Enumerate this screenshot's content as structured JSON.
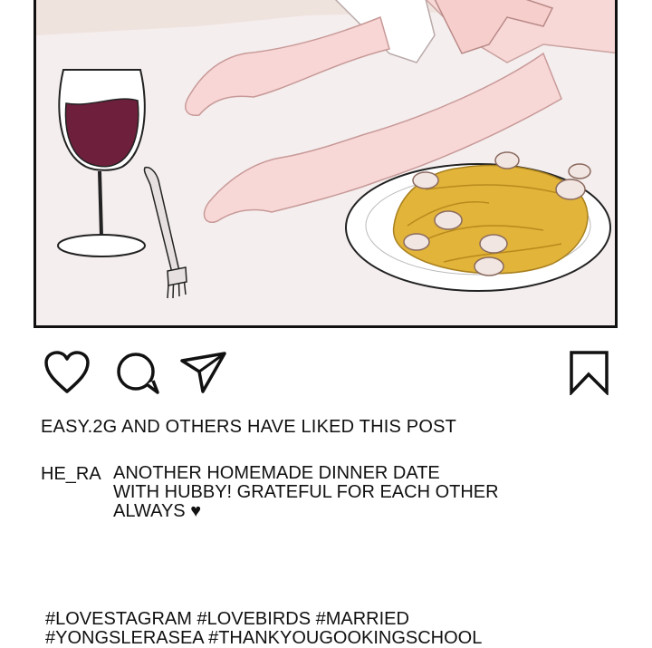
{
  "post": {
    "image_alt": "Illustration of two people's arms reaching across a dinner table with a glass of red wine, a fork and a plate of seafood pasta"
  },
  "actions": {
    "like_icon": "heart-outline",
    "comment_icon": "speech-bubble",
    "share_icon": "paper-plane",
    "save_icon": "bookmark"
  },
  "likes_text": "EASY.2G AND OTHERS HAVE LIKED THIS POST",
  "caption": {
    "username": "HE_RA",
    "line1": "ANOTHER HOMEMADE DINNER DATE",
    "line2": "WITH HUBBY! GRATEFUL FOR EACH OTHER",
    "line3": "ALWAYS",
    "emoji": "♥"
  },
  "hashtags": {
    "line1": "#LOVESTAGRAM #LOVEBIRDS #MARRIED",
    "line2": "#YONGSLERASEA #THANKYOUGOOKINGSCHOOL"
  }
}
